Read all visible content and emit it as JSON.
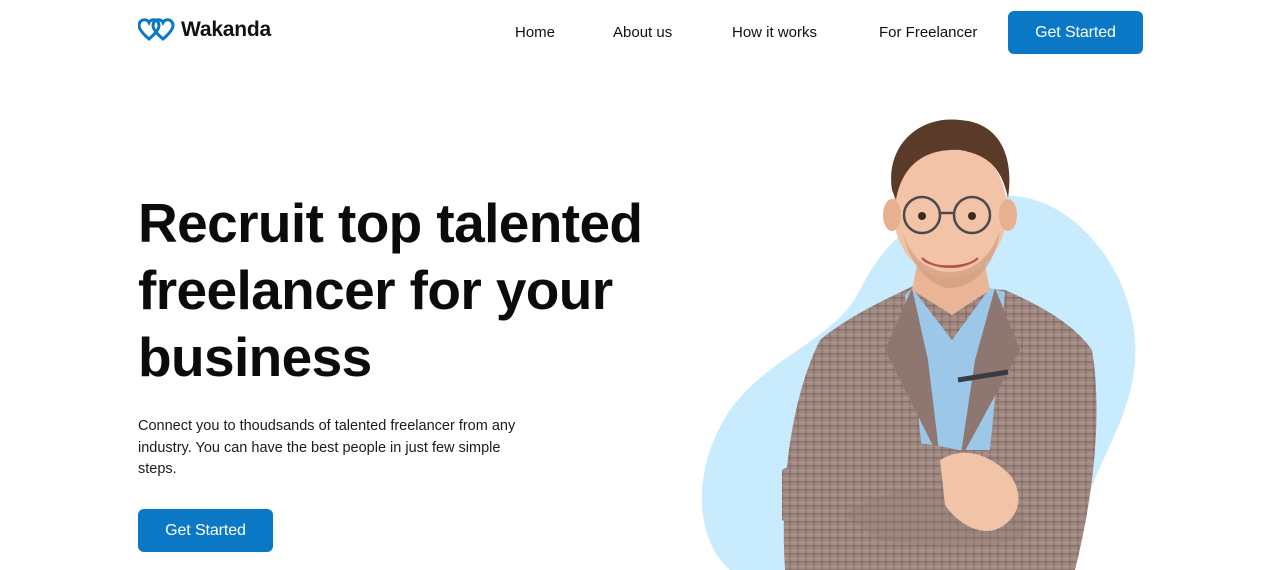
{
  "brand": {
    "name": "Wakanda",
    "logo_icon": "double-heart-icon"
  },
  "nav": {
    "items": [
      {
        "label": "Home"
      },
      {
        "label": "About us"
      },
      {
        "label": "How it works"
      },
      {
        "label": "For Freelancer"
      }
    ],
    "cta_label": "Get Started"
  },
  "hero": {
    "title": "Recruit top talented freelancer for your business",
    "subtitle": "Connect you to thoudsands of talented freelancer from any industry. You can have the best people in just few simple steps.",
    "cta_label": "Get Started",
    "image": "smiling-man-in-glasses-and-plaid-blazer"
  },
  "colors": {
    "primary": "#0a78c5",
    "blob": "#c8ebfd",
    "text": "#0b0b0b",
    "background": "#ffffff"
  }
}
